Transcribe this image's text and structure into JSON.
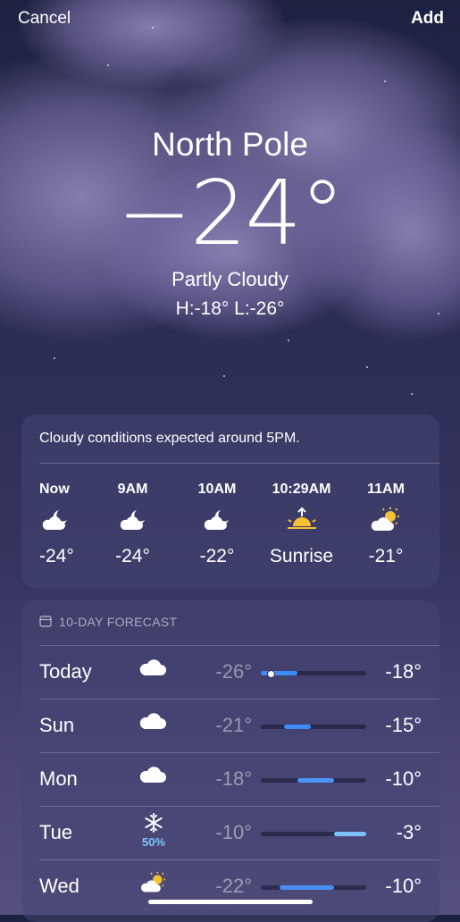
{
  "topbar": {
    "cancel": "Cancel",
    "add": "Add"
  },
  "hero": {
    "city": "North Pole",
    "temp": "−24°",
    "condition": "Partly Cloudy",
    "high_low": "H:-18°  L:-26°"
  },
  "hourly": {
    "summary": "Cloudy conditions expected around 5PM.",
    "items": [
      {
        "time": "Now",
        "icon": "partly-cloudy-night-icon",
        "value": "-24°"
      },
      {
        "time": "9AM",
        "icon": "partly-cloudy-night-icon",
        "value": "-24°"
      },
      {
        "time": "10AM",
        "icon": "partly-cloudy-night-icon",
        "value": "-22°"
      },
      {
        "time": "10:29AM",
        "icon": "sunrise-icon",
        "value": "Sunrise"
      },
      {
        "time": "11AM",
        "icon": "partly-sunny-icon",
        "value": "-21°"
      }
    ]
  },
  "daily": {
    "header": "10-DAY FORECAST",
    "range": [
      -26,
      -3
    ],
    "days": [
      {
        "name": "Today",
        "icon": "cloud-icon",
        "low": "-26°",
        "high": "-18°",
        "lo_val": -26,
        "hi_val": -18,
        "current": -24,
        "color": "#3c8cf5"
      },
      {
        "name": "Sun",
        "icon": "cloud-icon",
        "low": "-21°",
        "high": "-15°",
        "lo_val": -21,
        "hi_val": -15,
        "color": "#3c8cf5"
      },
      {
        "name": "Mon",
        "icon": "cloud-icon",
        "low": "-18°",
        "high": "-10°",
        "lo_val": -18,
        "hi_val": -10,
        "color": "#4a94f6"
      },
      {
        "name": "Tue",
        "icon": "snowflake-icon",
        "precip": "50%",
        "low": "-10°",
        "high": "-3°",
        "lo_val": -10,
        "hi_val": -3,
        "color": "#7cc0f9"
      },
      {
        "name": "Wed",
        "icon": "partly-sunny-icon",
        "low": "-22°",
        "high": "-10°",
        "lo_val": -22,
        "hi_val": -10,
        "color": "#4a8ef5"
      }
    ]
  }
}
